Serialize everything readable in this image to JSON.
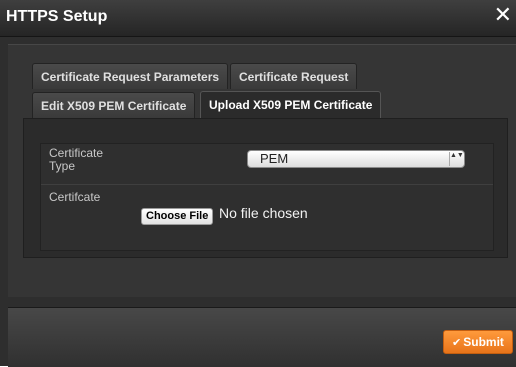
{
  "dialog": {
    "title": "HTTPS Setup",
    "close_glyph": "✕"
  },
  "tabs": [
    {
      "label": "Certificate Request Parameters",
      "active": false
    },
    {
      "label": "Certificate Request",
      "active": false
    },
    {
      "label": "Edit X509 PEM Certificate",
      "active": false
    },
    {
      "label": "Upload X509 PEM Certificate",
      "active": true
    }
  ],
  "form": {
    "certificate_type": {
      "label": "Certificate Type",
      "selected": "PEM",
      "arrows": "▲▼"
    },
    "certificate_file": {
      "label": "Certifcate",
      "button_label": "Choose File",
      "status": "No file chosen"
    }
  },
  "footer": {
    "submit_label": "Submit",
    "submit_icon": "check-icon",
    "accent_color": "#f28a2a"
  }
}
